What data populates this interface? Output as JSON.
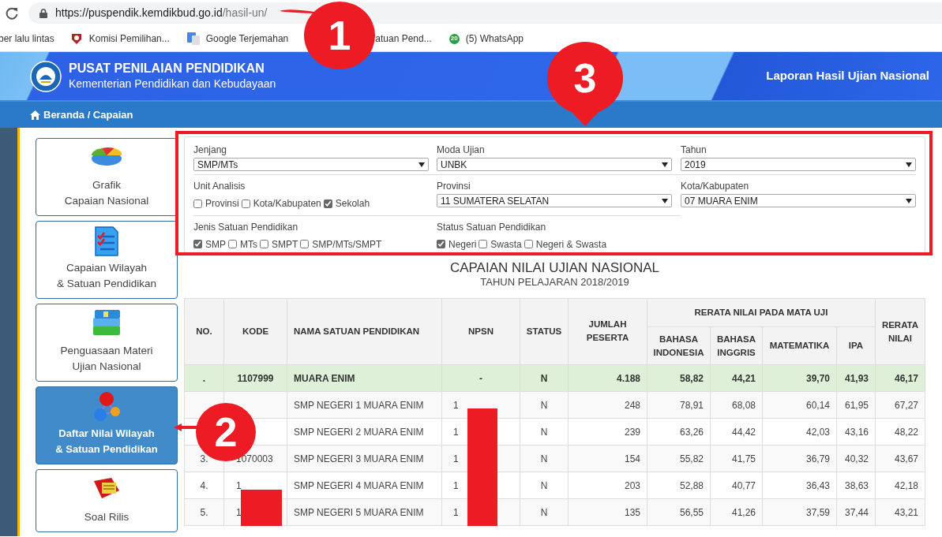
{
  "browser": {
    "url_host": "https://puspendik.kemdikbud.go.id",
    "url_path": "/hasil-un/",
    "bookmarks": [
      {
        "kind": "cut",
        "label": "ber lalu lintas"
      },
      {
        "kind": "emblem",
        "label": "Komisi Pemilihan..."
      },
      {
        "kind": "translate",
        "label": "Google Terjemahan"
      },
      {
        "kind": "covered",
        "label": "atuan Pend..."
      },
      {
        "kind": "chat",
        "label": "(5) WhatsApp",
        "badge": "20"
      }
    ]
  },
  "header": {
    "title": "PUSAT PENILAIAN PENDIDIKAN",
    "subtitle": "Kementerian Pendidikan dan Kebudayaan",
    "right_title": "Laporan Hasil Ujian Nasional"
  },
  "breadcrumb": "Beranda / Capaian",
  "menu": [
    {
      "kind": "pie",
      "lines": [
        "Grafik",
        "Capaian Nasional"
      ],
      "selected": false
    },
    {
      "kind": "checklist",
      "lines": [
        "Capaian Wilayah",
        "& Satuan Pendidikan"
      ],
      "selected": false
    },
    {
      "kind": "books",
      "lines": [
        "Penguasaan Materi",
        "Ujian Nasional"
      ],
      "selected": false
    },
    {
      "kind": "nodes",
      "lines": [
        "Daftar Nilai Wilayah",
        "& Satuan Pendidikan"
      ],
      "selected": true
    },
    {
      "kind": "binder",
      "lines": [
        "Soal Rilis"
      ],
      "selected": false
    }
  ],
  "filters": [
    {
      "kind": "select",
      "label": "Jenjang",
      "value": "SMP/MTs"
    },
    {
      "kind": "select",
      "label": "Moda Ujian",
      "value": "UNBK"
    },
    {
      "kind": "select",
      "label": "Tahun",
      "value": "2019"
    },
    {
      "kind": "checks",
      "label": "Unit Analisis",
      "options": [
        {
          "label": "Provinsi",
          "checked": false
        },
        {
          "label": "Kota/Kabupaten",
          "checked": false
        },
        {
          "label": "Sekolah",
          "checked": true
        }
      ]
    },
    {
      "kind": "select",
      "label": "Provinsi",
      "value": "11 SUMATERA SELATAN"
    },
    {
      "kind": "select",
      "label": "Kota/Kabupaten",
      "value": "07 MUARA ENIM"
    },
    {
      "kind": "checks",
      "label": "Jenis Satuan Pendidikan",
      "options": [
        {
          "label": "SMP",
          "checked": true
        },
        {
          "label": "MTs",
          "checked": false
        },
        {
          "label": "SMPT",
          "checked": false
        },
        {
          "label": "SMP/MTs/SMPT",
          "checked": false
        }
      ]
    },
    {
      "kind": "checks",
      "label": "Status Satuan Pendidikan",
      "options": [
        {
          "label": "Negeri",
          "checked": true
        },
        {
          "label": "Swasta",
          "checked": false
        },
        {
          "label": "Negeri & Swasta",
          "checked": false
        }
      ]
    }
  ],
  "report": {
    "title": "CAPAIAN NILAI UJIAN NASIONAL",
    "subtitle": "TAHUN PELAJARAN 2018/2019"
  },
  "table": {
    "columns": [
      "NO.",
      "KODE",
      "NAMA SATUAN PENDIDIKAN",
      "NPSN",
      "STATUS",
      "JUMLAH PESERTA"
    ],
    "group": "RERATA NILAI PADA MATA UJI",
    "subjects": [
      "BAHASA INDONESIA",
      "BAHASA INGGRIS",
      "MATEMATIKA",
      "IPA"
    ],
    "last": "RERATA NILAI",
    "rows": [
      {
        "kind": "total",
        "no": ".",
        "kode": "1107999",
        "nama": "MUARA ENIM",
        "npsn": "-",
        "status": "N",
        "jumlah": "4.188",
        "scores": [
          "58,82",
          "44,21",
          "39,70",
          "41,93"
        ],
        "rerata": "46,17"
      },
      {
        "kind": "school",
        "nama": "SMP NEGERI 1 MUARA ENIM",
        "npsn": "1",
        "status": "N",
        "jumlah": "248",
        "scores": [
          "78,91",
          "68,08",
          "60,14",
          "61,95"
        ],
        "rerata": "67,27"
      },
      {
        "kind": "school",
        "nama": "SMP NEGERI 2 MUARA ENIM",
        "npsn": "1",
        "status": "N",
        "jumlah": "239",
        "scores": [
          "63,26",
          "44,42",
          "42,03",
          "43,16"
        ],
        "rerata": "48,22"
      },
      {
        "kind": "school",
        "no": "3.",
        "kode": "1070003",
        "nama": "SMP NEGERI 3 MUARA ENIM",
        "npsn": "1",
        "status": "N",
        "jumlah": "154",
        "scores": [
          "55,82",
          "41,75",
          "36,79",
          "40,32"
        ],
        "rerata": "43,67"
      },
      {
        "kind": "school",
        "no": "4.",
        "kode": "1",
        "nama": "SMP NEGERI 4 MUARA ENIM",
        "npsn": "1",
        "status": "N",
        "jumlah": "203",
        "scores": [
          "52,88",
          "40,77",
          "36,43",
          "38,63"
        ],
        "rerata": "42,18"
      },
      {
        "kind": "school",
        "no": "5.",
        "kode": "1",
        "nama": "SMP NEGERI 5 MUARA ENIM",
        "npsn": "1",
        "status": "N",
        "jumlah": "135",
        "scores": [
          "56,55",
          "41,26",
          "37,59",
          "37,44"
        ],
        "rerata": "43,21"
      }
    ]
  },
  "annotations": {
    "highlight_frame": true,
    "markers": [
      {
        "text": "1"
      },
      {
        "text": "2"
      },
      {
        "text": "3"
      }
    ],
    "redactions": [
      {
        "kind": "block"
      },
      {
        "kind": "block"
      }
    ]
  }
}
